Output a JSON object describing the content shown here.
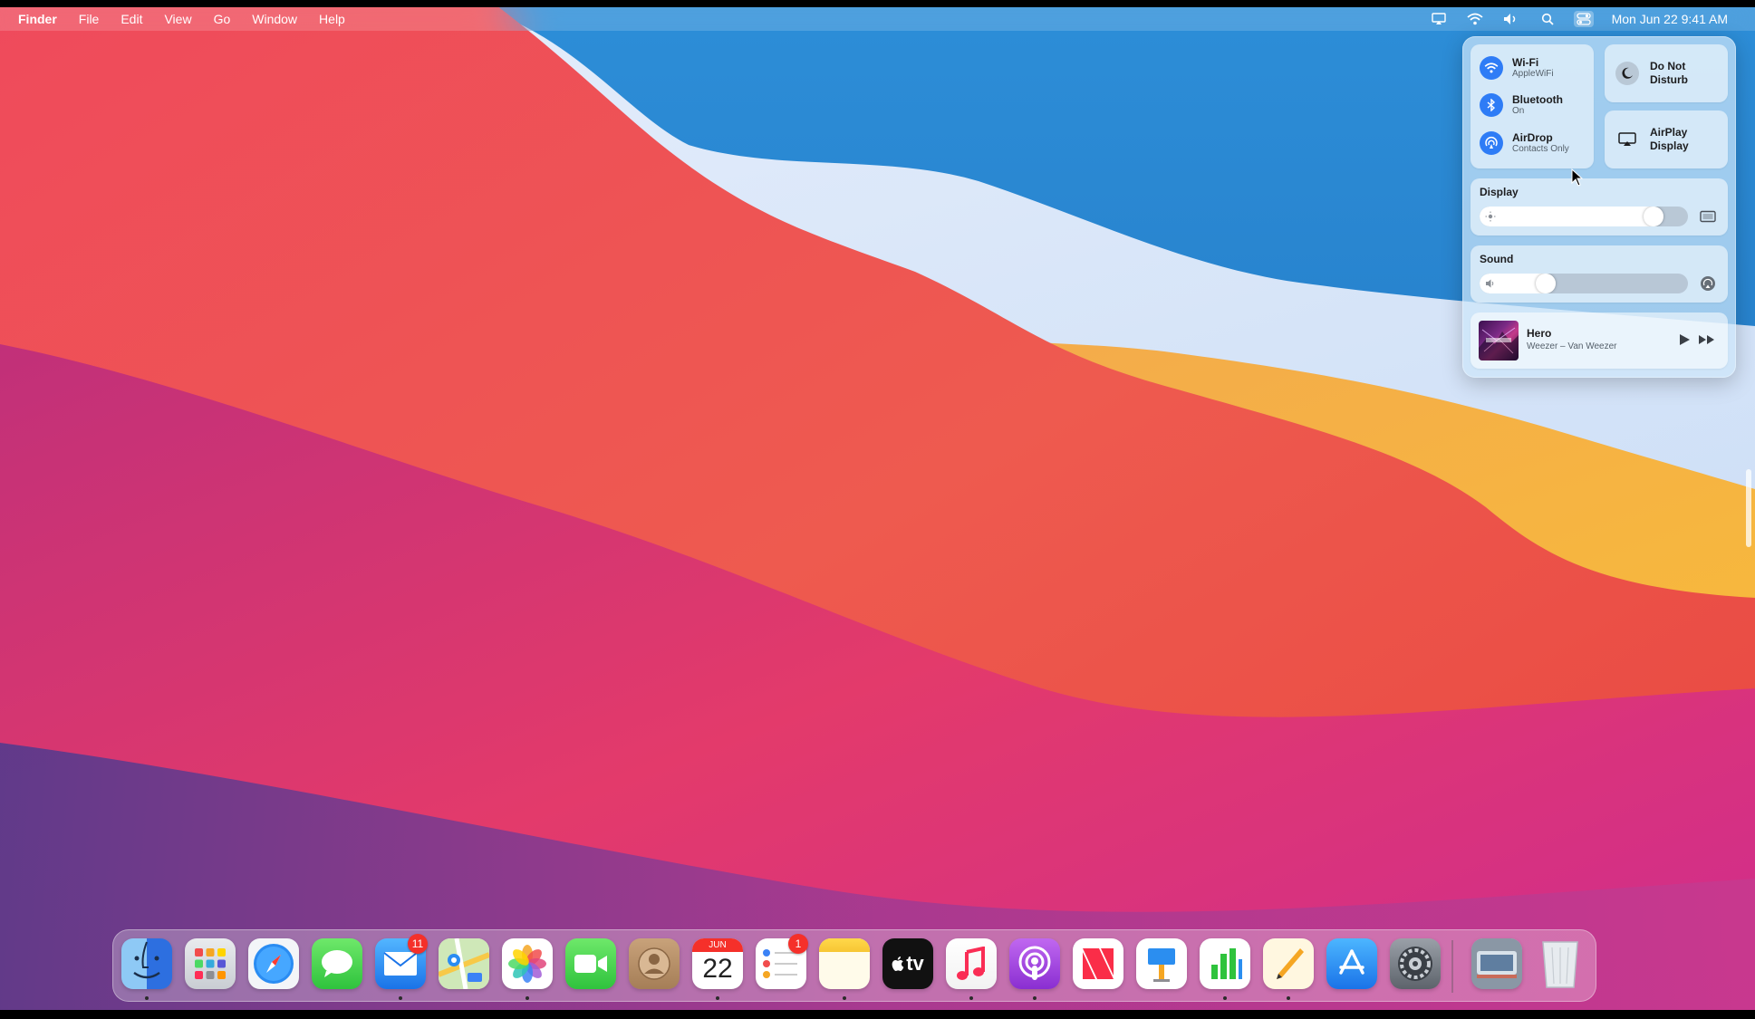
{
  "menubar": {
    "app_name": "Finder",
    "menus": [
      "File",
      "Edit",
      "View",
      "Go",
      "Window",
      "Help"
    ],
    "clock": "Mon Jun 22  9:41 AM",
    "status_icons": [
      "airplay-icon",
      "wifi-icon",
      "volume-icon",
      "spotlight-search-icon",
      "control-center-icon"
    ]
  },
  "control_center": {
    "wifi": {
      "title": "Wi-Fi",
      "subtitle": "AppleWiFi"
    },
    "bluetooth": {
      "title": "Bluetooth",
      "subtitle": "On"
    },
    "airdrop": {
      "title": "AirDrop",
      "subtitle": "Contacts Only"
    },
    "dnd_label": "Do Not Disturb",
    "airplay_label": "AirPlay Display",
    "display": {
      "title": "Display",
      "level_fraction": 0.87
    },
    "sound": {
      "title": "Sound",
      "level_fraction": 0.3
    },
    "now_playing": {
      "title": "Hero",
      "artist": "Weezer – Van Weezer"
    }
  },
  "dock": {
    "apps": [
      {
        "name": "Finder",
        "running": true
      },
      {
        "name": "Launchpad",
        "running": false
      },
      {
        "name": "Safari",
        "running": false
      },
      {
        "name": "Messages",
        "running": false
      },
      {
        "name": "Mail",
        "running": true,
        "badge": "11"
      },
      {
        "name": "Maps",
        "running": false
      },
      {
        "name": "Photos",
        "running": true
      },
      {
        "name": "FaceTime",
        "running": false
      },
      {
        "name": "Contacts",
        "running": false
      },
      {
        "name": "Calendar",
        "running": true,
        "month": "JUN",
        "day": "22"
      },
      {
        "name": "Reminders",
        "running": false,
        "badge": "1"
      },
      {
        "name": "Notes",
        "running": true
      },
      {
        "name": "TV",
        "running": false,
        "label": "tv"
      },
      {
        "name": "Music",
        "running": true
      },
      {
        "name": "Podcasts",
        "running": true
      },
      {
        "name": "News",
        "running": false
      },
      {
        "name": "Keynote",
        "running": false
      },
      {
        "name": "Numbers",
        "running": true
      },
      {
        "name": "Pages",
        "running": true
      },
      {
        "name": "App Store",
        "running": false
      },
      {
        "name": "System Preferences",
        "running": false
      }
    ],
    "extras": [
      "Downloads stack",
      "Trash"
    ]
  },
  "colors": {
    "accent_blue": "#2e7cf6",
    "badge_red": "#f5302a"
  }
}
